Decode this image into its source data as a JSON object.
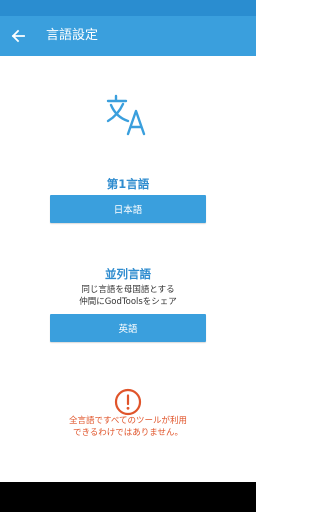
{
  "app_bar": {
    "title": "言語設定",
    "back_icon": "arrow-left-icon"
  },
  "header_icon": "translate-icon",
  "primary_language": {
    "title": "第1言語",
    "button_label": "日本語"
  },
  "parallel_language": {
    "title": "並列言語",
    "description_line1": "同じ言語を母国語とする",
    "description_line2": "仲間にGodToolsをシェア",
    "button_label": "英語"
  },
  "warning": {
    "icon": "alert-circle-icon",
    "line1": "全言語ですべてのツールが利用",
    "line2": "できるわけではありません。"
  },
  "colors": {
    "status_bar": "#2a8dd0",
    "app_bar": "#3a9fdd",
    "accent_text": "#2f8ccf",
    "warning": "#e0542a"
  }
}
